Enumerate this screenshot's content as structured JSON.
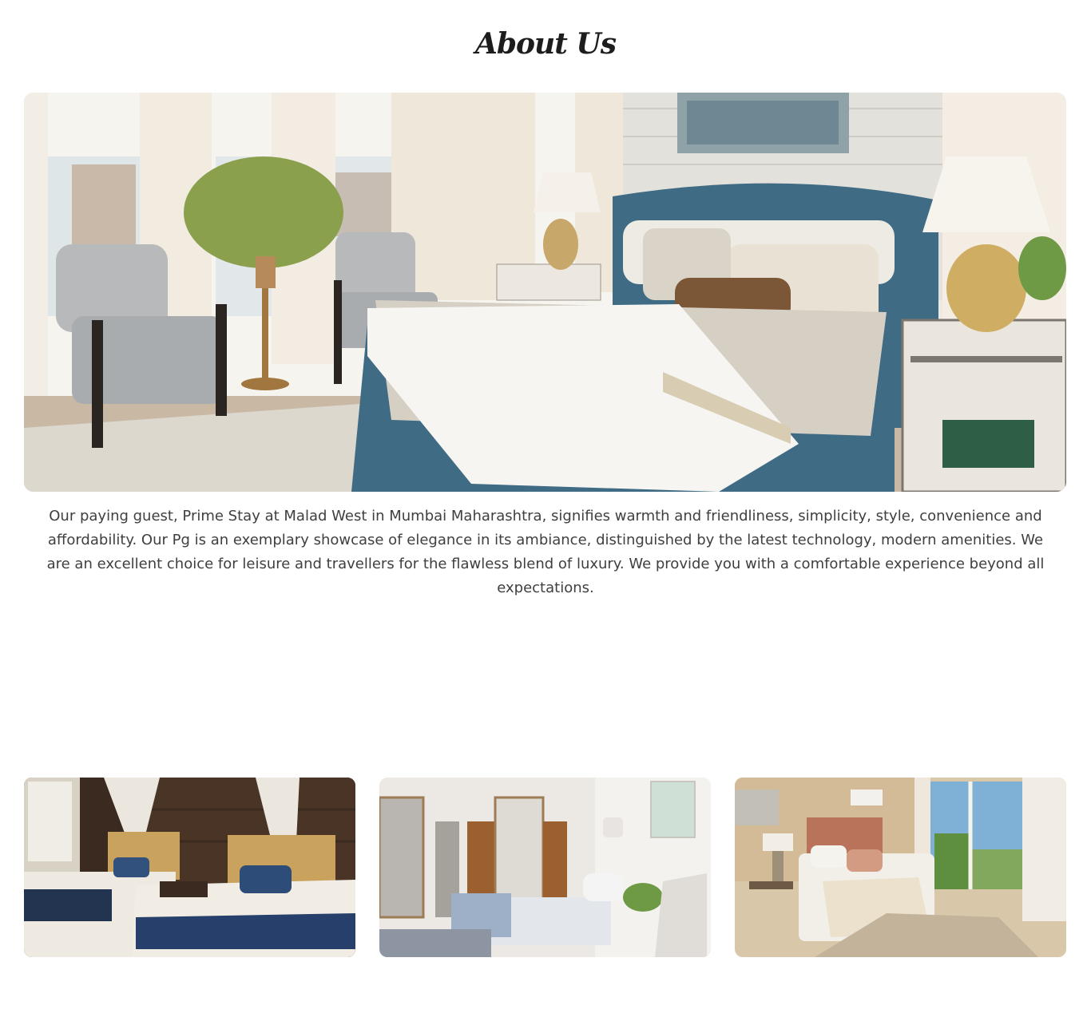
{
  "section": {
    "title": "About Us",
    "description": "Our paying guest, Prime Stay at Malad West in Mumbai Maharashtra, signifies warmth and friendliness, simplicity, style, convenience and affordability. Our Pg is an exemplary showcase of elegance in its ambiance, distinguished by the latest technology, modern amenities. We are an excellent choice for leisure and travellers for the flawless blend of luxury. We provide you with a comfortable experience beyond all expectations."
  },
  "images": {
    "hero": "bedroom-photo",
    "thumbnails": [
      "twin-bedroom-photo",
      "bedroom-with-wardrobe-photo",
      "bedroom-with-window-photo"
    ]
  },
  "colors": {
    "title": "#1d1d1d",
    "text": "#3f3f3f",
    "bed_blue": "#3f6b85"
  }
}
